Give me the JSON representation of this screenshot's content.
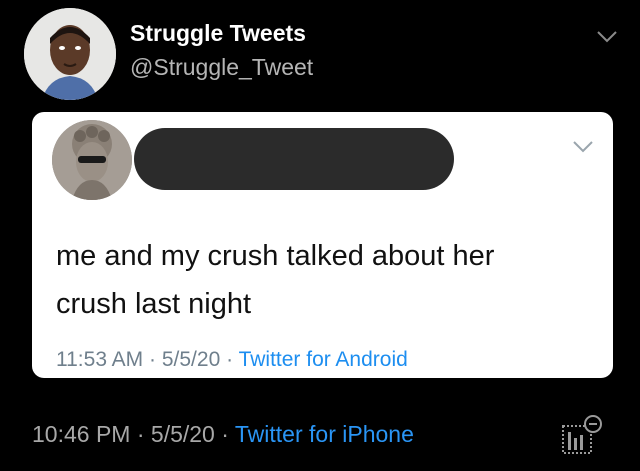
{
  "outer_tweet": {
    "display_name": "Struggle Tweets",
    "handle": "@Struggle_Tweet",
    "time": "10:46 PM",
    "date": "5/5/20",
    "separator": "·",
    "source": "Twitter for iPhone",
    "avatar_icon": "profile-photo-icon",
    "menu_icon": "chevron-down-icon",
    "analytics_icon": "analytics-icon"
  },
  "quoted_tweet": {
    "text_line1": "me and my crush talked about her",
    "text_line2": "crush last night",
    "time": "11:53 AM",
    "date": "5/5/20",
    "separator": "·",
    "source": "Twitter for Android",
    "avatar_icon": "statue-profile-icon",
    "menu_icon": "chevron-down-icon"
  },
  "colors": {
    "background": "#000000",
    "card": "#ffffff",
    "link": "#1d8ef0",
    "redaction": "#2b2b2b"
  }
}
